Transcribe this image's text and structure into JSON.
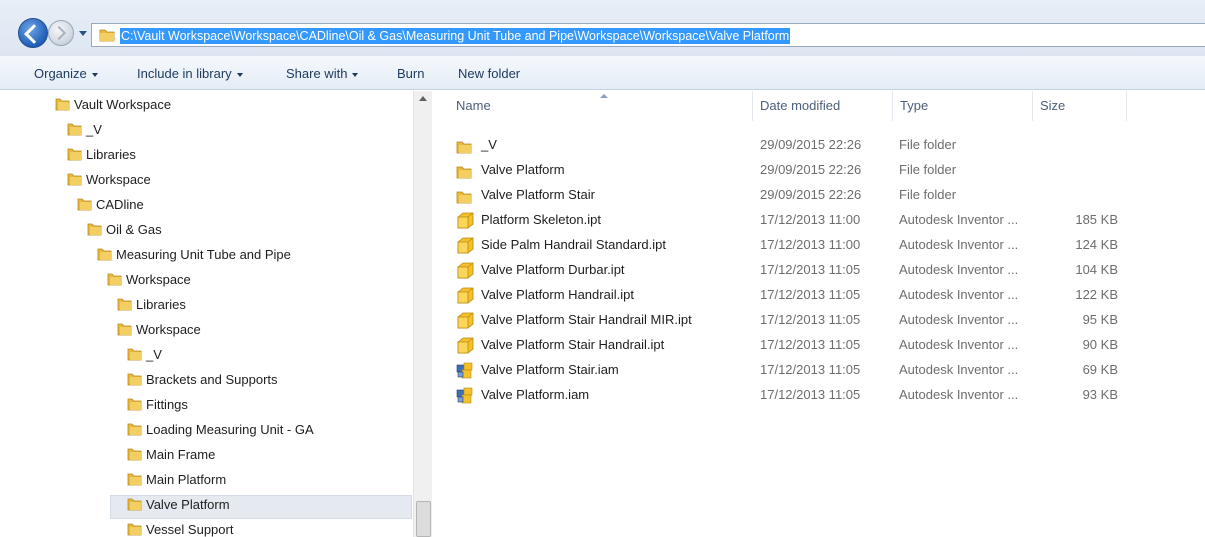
{
  "address_bar": {
    "path": "C:\\Vault Workspace\\Workspace\\CADline\\Oil & Gas\\Measuring Unit Tube and Pipe\\Workspace\\Workspace\\Valve Platform"
  },
  "toolbar": {
    "organize": "Organize",
    "include_in_library": "Include in library",
    "share_with": "Share with",
    "burn": "Burn",
    "new_folder": "New folder"
  },
  "navigation_tree": [
    {
      "label": "Vault Workspace"
    },
    {
      "label": "_V"
    },
    {
      "label": "Libraries"
    },
    {
      "label": "Workspace"
    },
    {
      "label": "CADline"
    },
    {
      "label": "Oil & Gas"
    },
    {
      "label": "Measuring Unit Tube and Pipe"
    },
    {
      "label": "Workspace"
    },
    {
      "label": "Libraries"
    },
    {
      "label": "Workspace"
    },
    {
      "label": "_V"
    },
    {
      "label": "Brackets and Supports"
    },
    {
      "label": "Fittings"
    },
    {
      "label": "Loading Measuring Unit - GA"
    },
    {
      "label": "Main Frame"
    },
    {
      "label": "Main Platform"
    },
    {
      "label": "Valve Platform",
      "selected": true
    },
    {
      "label": "Vessel Support"
    }
  ],
  "columns": {
    "name": "Name",
    "date_modified": "Date modified",
    "type": "Type",
    "size": "Size"
  },
  "files": [
    {
      "name": "_V",
      "date": "29/09/2015 22:26",
      "type": "File folder",
      "size": "",
      "icon": "folder-icon"
    },
    {
      "name": "Valve Platform",
      "date": "29/09/2015 22:26",
      "type": "File folder",
      "size": "",
      "icon": "folder-icon"
    },
    {
      "name": "Valve Platform Stair",
      "date": "29/09/2015 22:26",
      "type": "File folder",
      "size": "",
      "icon": "folder-icon"
    },
    {
      "name": "Platform Skeleton.ipt",
      "date": "17/12/2013 11:00",
      "type": "Autodesk Inventor ...",
      "size": "185 KB",
      "icon": "part-icon"
    },
    {
      "name": "Side Palm Handrail Standard.ipt",
      "date": "17/12/2013 11:00",
      "type": "Autodesk Inventor ...",
      "size": "124 KB",
      "icon": "part-icon"
    },
    {
      "name": "Valve Platform Durbar.ipt",
      "date": "17/12/2013 11:05",
      "type": "Autodesk Inventor ...",
      "size": "104 KB",
      "icon": "part-icon"
    },
    {
      "name": "Valve Platform Handrail.ipt",
      "date": "17/12/2013 11:05",
      "type": "Autodesk Inventor ...",
      "size": "122 KB",
      "icon": "part-icon"
    },
    {
      "name": "Valve Platform Stair Handrail MIR.ipt",
      "date": "17/12/2013 11:05",
      "type": "Autodesk Inventor ...",
      "size": "95 KB",
      "icon": "part-icon"
    },
    {
      "name": "Valve Platform Stair Handrail.ipt",
      "date": "17/12/2013 11:05",
      "type": "Autodesk Inventor ...",
      "size": "90 KB",
      "icon": "part-icon"
    },
    {
      "name": "Valve Platform Stair.iam",
      "date": "17/12/2013 11:05",
      "type": "Autodesk Inventor ...",
      "size": "69 KB",
      "icon": "assembly-icon"
    },
    {
      "name": "Valve Platform.iam",
      "date": "17/12/2013 11:05",
      "type": "Autodesk Inventor ...",
      "size": "93 KB",
      "icon": "assembly-icon"
    }
  ],
  "colors": {
    "selection": "#3399ff",
    "folder": "#e8b83a",
    "part": "#f5c02a",
    "assembly_blue": "#3d6fb8"
  }
}
